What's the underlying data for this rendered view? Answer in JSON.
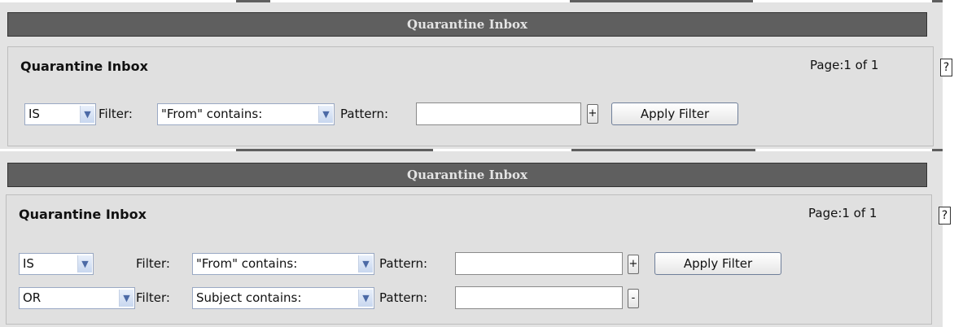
{
  "panel1": {
    "header": "Quarantine Inbox",
    "title": "Quarantine Inbox",
    "page_info": "Page:1 of 1",
    "help": "?",
    "rows": [
      {
        "logic": "IS",
        "filter_label": "Filter:",
        "filter": "\"From\" contains:",
        "pattern_label": "Pattern:",
        "pattern": "",
        "toggle": "+",
        "apply": "Apply Filter"
      }
    ]
  },
  "panel2": {
    "header": "Quarantine Inbox",
    "title": "Quarantine Inbox",
    "page_info": "Page:1 of 1",
    "help": "?",
    "rows": [
      {
        "logic": "IS",
        "filter_label": "Filter:",
        "filter": "\"From\" contains:",
        "pattern_label": "Pattern:",
        "pattern": "",
        "toggle": "+",
        "apply": "Apply Filter"
      },
      {
        "logic": "OR",
        "filter_label": "Filter:",
        "filter": "Subject contains:",
        "pattern_label": "Pattern:",
        "pattern": "",
        "toggle": "-"
      }
    ]
  },
  "icons": {
    "dropdown": "chevron-down-icon",
    "help": "help-icon",
    "add": "plus-icon",
    "remove": "minus-icon"
  },
  "colors": {
    "header_bar": "#5f5f5f",
    "header_text": "#e4e4e4",
    "panel_bg": "#e3e3e3",
    "dropdown_arrow": "#4c6aa6"
  }
}
